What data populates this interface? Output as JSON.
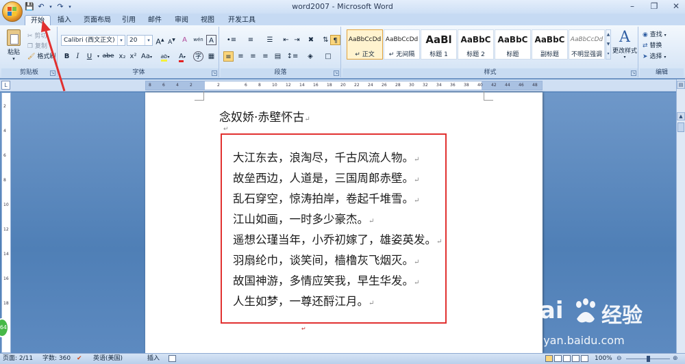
{
  "window": {
    "title": "word2007 - Microsoft Word"
  },
  "qat": {
    "save": "save-icon",
    "undo": "undo-icon",
    "redo": "redo-icon"
  },
  "tabs": [
    {
      "label": "开始",
      "active": true
    },
    {
      "label": "插入"
    },
    {
      "label": "页面布局"
    },
    {
      "label": "引用"
    },
    {
      "label": "邮件"
    },
    {
      "label": "审阅"
    },
    {
      "label": "视图"
    },
    {
      "label": "开发工具"
    }
  ],
  "ribbon": {
    "clipboard": {
      "label": "剪贴板",
      "paste": "粘贴",
      "cut": "剪切",
      "copy": "复制",
      "format_painter": "格式刷"
    },
    "font": {
      "label": "字体",
      "font_name": "Calibri (西文正文)",
      "font_size": "20",
      "bold": "B",
      "italic": "I",
      "underline": "U",
      "strike": "abe",
      "subscript": "x₂",
      "superscript": "x²",
      "change_case": "Aa",
      "highlight": "ab",
      "font_color": "A",
      "grow": "A",
      "shrink": "A",
      "clear": "A",
      "phonetic": "wén",
      "char_border": "A"
    },
    "paragraph": {
      "label": "段落"
    },
    "styles": {
      "label": "样式",
      "items": [
        {
          "sample": "AaBbCcDd",
          "name": "↵ 正文",
          "selected": true
        },
        {
          "sample": "AaBbCcDd",
          "name": "↵ 无间隔"
        },
        {
          "sample": "AaBl",
          "name": "标题 1"
        },
        {
          "sample": "AaBbC",
          "name": "标题 2"
        },
        {
          "sample": "AaBbC",
          "name": "标题"
        },
        {
          "sample": "AaBbC",
          "name": "副标题"
        },
        {
          "sample": "AaBbCcDd",
          "name": "不明显强调"
        }
      ],
      "change_styles": "更改样式"
    },
    "editing": {
      "label": "编辑",
      "find": "查找",
      "replace": "替换",
      "select": "选择"
    }
  },
  "ruler": {
    "ticks": [
      "8",
      "6",
      "4",
      "2",
      "",
      "2",
      "",
      "6",
      "8",
      "10",
      "12",
      "14",
      "16",
      "18",
      "20",
      "22",
      "24",
      "26",
      "28",
      "30",
      "32",
      "34",
      "36",
      "38",
      "40",
      "42",
      "44",
      "46",
      "48"
    ]
  },
  "vruler": {
    "ticks": [
      "2",
      "4",
      "6",
      "8",
      "10",
      "12",
      "14",
      "16",
      "18",
      "20"
    ]
  },
  "document": {
    "title": "念奴娇·赤壁怀古",
    "lines": [
      "大江东去，浪淘尽，千古风流人物。",
      "故垒西边，人道是，三国周郎赤壁。",
      "乱石穿空，惊涛拍岸，卷起千堆雪。",
      "江山如画，一时多少豪杰。",
      "遥想公瑾当年，小乔初嫁了，雄姿英发。",
      "羽扇纶巾，谈笑间，樯橹灰飞烟灭。",
      "故国神游，多情应笑我，早生华发。",
      "人生如梦，一尊还酹江月。"
    ]
  },
  "status": {
    "page": "页面: 2/11",
    "words": "字数: 360",
    "language": "英语(美国)",
    "mode": "插入",
    "zoom": "100%"
  },
  "badge": "64",
  "watermark": {
    "brand": "Bai",
    "brand2": "经验",
    "url": "jingyan.baidu.com"
  },
  "colors": {
    "accent_red": "#e1302f",
    "ribbon": "#dbe8f7",
    "docbg": "#4f7fb6"
  }
}
